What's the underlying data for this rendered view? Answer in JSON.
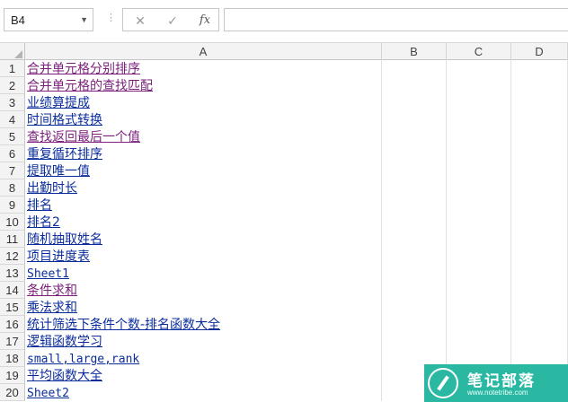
{
  "formula_bar": {
    "name_box": "B4",
    "separator": "⋮",
    "cancel": "✕",
    "enter": "✓",
    "fx": "fx",
    "formula": ""
  },
  "columns": [
    "A",
    "B",
    "C",
    "D"
  ],
  "rows": [
    {
      "num": "1",
      "text": "合并单元格分别排序",
      "visited": true
    },
    {
      "num": "2",
      "text": "合并单元格的查找匹配",
      "visited": true
    },
    {
      "num": "3",
      "text": "业绩算提成",
      "visited": false
    },
    {
      "num": "4",
      "text": "时间格式转换",
      "visited": false
    },
    {
      "num": "5",
      "text": "查找返回最后一个值",
      "visited": true
    },
    {
      "num": "6",
      "text": "重复循环排序",
      "visited": false
    },
    {
      "num": "7",
      "text": "提取唯一值",
      "visited": false
    },
    {
      "num": "8",
      "text": "出勤时长",
      "visited": false
    },
    {
      "num": "9",
      "text": "排名",
      "visited": false
    },
    {
      "num": "10",
      "text": "排名2",
      "visited": false
    },
    {
      "num": "11",
      "text": "随机抽取姓名",
      "visited": false
    },
    {
      "num": "12",
      "text": "项目进度表",
      "visited": false
    },
    {
      "num": "13",
      "text": "Sheet1",
      "visited": false
    },
    {
      "num": "14",
      "text": "条件求和",
      "visited": true
    },
    {
      "num": "15",
      "text": "乘法求和",
      "visited": false
    },
    {
      "num": "16",
      "text": "统计筛选下条件个数-排名函数大全",
      "visited": false
    },
    {
      "num": "17",
      "text": "逻辑函数学习",
      "visited": false
    },
    {
      "num": "18",
      "text": "small,large,rank",
      "visited": false
    },
    {
      "num": "19",
      "text": "平均函数大全",
      "visited": false
    },
    {
      "num": "20",
      "text": "Sheet2",
      "visited": false
    }
  ],
  "colors": {
    "link": "#0b2d9c",
    "visited": "#7a1f7a",
    "watermark": "#2bb8a3"
  },
  "watermark": {
    "name": "笔记部落",
    "site": "www.notetribe.com",
    "icon": "pen-icon"
  }
}
